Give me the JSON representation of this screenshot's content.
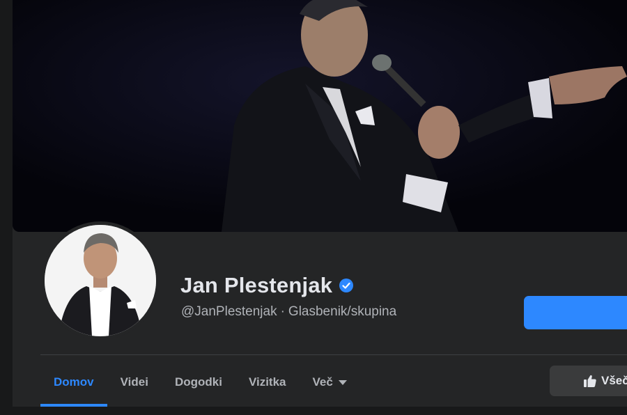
{
  "profile": {
    "name": "Jan Plestenjak",
    "handle": "@JanPlestenjak",
    "separator": "·",
    "category": "Glasbenik/skupina"
  },
  "icons": {
    "verified": "verified-badge-icon",
    "tab_more": "caret-down-icon",
    "like": "thumbs-up-icon"
  },
  "tabs": [
    {
      "label": "Domov",
      "active": true
    },
    {
      "label": "Videi"
    },
    {
      "label": "Dogodki"
    },
    {
      "label": "Vizitka"
    },
    {
      "label": "Več"
    }
  ],
  "actions": {
    "like_label": "Všeč"
  },
  "colors": {
    "accent": "#2d88ff",
    "background": "#242526",
    "text_primary": "#e4e6eb",
    "text_secondary": "#b0b3b8"
  }
}
